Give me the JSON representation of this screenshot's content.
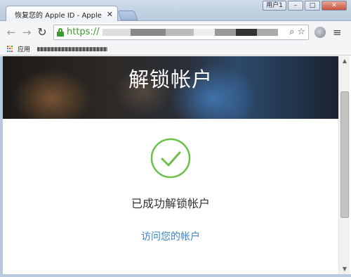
{
  "browser": {
    "tab": {
      "title": "恢复您的 Apple ID - Apple (",
      "close_label": "✕"
    },
    "window": {
      "user_label": "用户1",
      "minimize_label": "–",
      "maximize_label": "□",
      "close_label": "✕"
    },
    "toolbar": {
      "back_label": "←",
      "forward_label": "→",
      "reload_label": "↻",
      "url_scheme": "https://",
      "menu_label": "≡"
    },
    "bookmarks": {
      "apps_label": "应用"
    }
  },
  "page": {
    "hero_title": "解锁帐户",
    "success_text": "已成功解锁帐户",
    "account_link": "访问您的帐户"
  },
  "colors": {
    "accent_green": "#6cc04a",
    "link_blue": "#3b84c4",
    "secure_green": "#3a9a2d"
  },
  "icons": [
    "apple-icon",
    "lock-icon",
    "search-icon",
    "star-icon",
    "globe-icon",
    "menu-icon",
    "apps-icon",
    "checkmark-icon"
  ]
}
